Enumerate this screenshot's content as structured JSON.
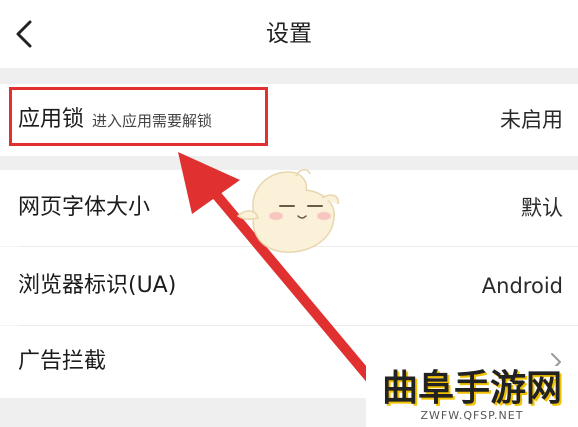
{
  "header": {
    "title": "设置",
    "back_icon": "chevron-left-icon"
  },
  "settings": {
    "app_lock": {
      "label": "应用锁",
      "subtitle": "进入应用需要解锁",
      "value": "未启用"
    },
    "font_size": {
      "label": "网页字体大小",
      "value": "默认"
    },
    "user_agent": {
      "label": "浏览器标识(UA)",
      "value": "Android"
    },
    "ad_block": {
      "label": "广告拦截",
      "chevron_icon": "chevron-right-icon"
    }
  },
  "annotation": {
    "highlight_color": "#e03030",
    "arrow_color": "#e03030"
  },
  "watermark": {
    "title": "曲阜手游网",
    "url": "ZWFW.QFSP.NET"
  }
}
